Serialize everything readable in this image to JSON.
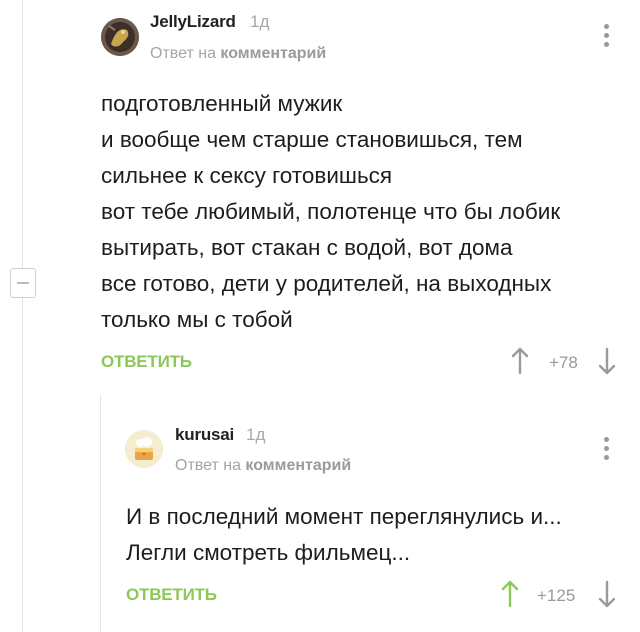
{
  "comments": [
    {
      "username": "JellyLizard",
      "time": "1д",
      "reply_prefix": "Ответ на",
      "reply_target": "комментарий",
      "lines": [
        "подготовленный мужик",
        "и вообще чем старше становишься, тем",
        "сильнее к сексу готовишься",
        "вот тебе любимый, полотенце что бы лобик",
        "вытирать, вот стакан с водой, вот дома",
        "все готово, дети у родителей, на выходных",
        "только мы с тобой"
      ],
      "reply_label": "ОТВЕТИТЬ",
      "rating": "+78",
      "upvoted": false
    },
    {
      "username": "kurusai",
      "time": "1д",
      "reply_prefix": "Ответ на",
      "reply_target": "комментарий",
      "lines": [
        "И в последний момент переглянулись и...",
        "Легли смотреть фильмец..."
      ],
      "reply_label": "ОТВЕТИТЬ",
      "rating": "+125",
      "upvoted": true
    }
  ],
  "colors": {
    "accent_green": "#8ac858",
    "muted_gray": "#9a9a9a"
  },
  "icons": [
    "collapse-thread-icon",
    "more-options-icon",
    "upvote-arrow-icon",
    "downvote-arrow-icon"
  ]
}
